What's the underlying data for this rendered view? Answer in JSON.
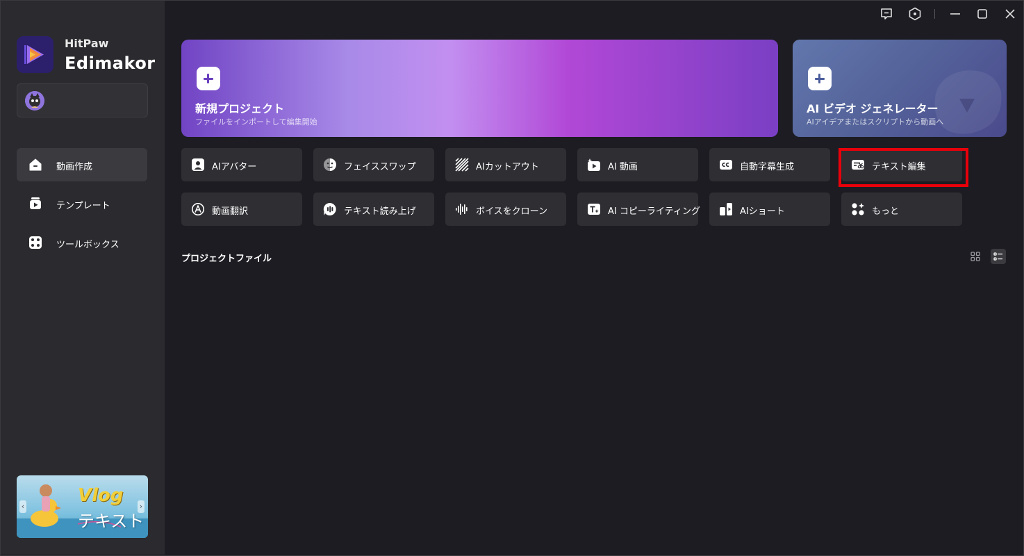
{
  "brand": {
    "line1": "HitPaw",
    "line2": "Edimakor"
  },
  "sidebar": {
    "items": [
      {
        "label": "動画作成",
        "icon": "home-icon",
        "active": true
      },
      {
        "label": "テンプレート",
        "icon": "template-icon",
        "active": false
      },
      {
        "label": "ツールボックス",
        "icon": "toolbox-icon",
        "active": false
      }
    ],
    "banner": {
      "title": "Vlog",
      "subtitle": "テキスト"
    }
  },
  "titlebar": {
    "icons": [
      "feedback-icon",
      "settings-hex-icon",
      "minimize-icon",
      "maximize-icon",
      "close-icon"
    ]
  },
  "hero": [
    {
      "title": "新規プロジェクト",
      "subtitle": "ファイルをインポートして編集開始"
    },
    {
      "title": "AI ビデオ ジェネレーター",
      "subtitle": "AIアイデアまたはスクリプトから動画へ"
    }
  ],
  "tools": [
    {
      "label": "AIアバター",
      "icon": "avatar-icon"
    },
    {
      "label": "フェイススワップ",
      "icon": "face-swap-icon"
    },
    {
      "label": "AIカットアウト",
      "icon": "cutout-icon"
    },
    {
      "label": "AI 動画",
      "icon": "ai-video-icon"
    },
    {
      "label": "自動字幕生成",
      "icon": "cc-icon"
    },
    {
      "label": "テキスト編集",
      "icon": "text-edit-icon"
    },
    {
      "label": "動画翻訳",
      "icon": "translate-icon"
    },
    {
      "label": "テキスト読み上げ",
      "icon": "tts-icon"
    },
    {
      "label": "ボイスをクローン",
      "icon": "voice-clone-icon"
    },
    {
      "label": "AI コピーライティング",
      "icon": "copywriting-icon"
    },
    {
      "label": "AIショート",
      "icon": "ai-short-icon"
    },
    {
      "label": "もっと",
      "icon": "more-icon"
    }
  ],
  "projects": {
    "title": "プロジェクトファイル",
    "view_mode": "list"
  },
  "colors": {
    "highlight": "#e8000a",
    "sidebar_bg": "#2b2b2f",
    "main_bg": "#1d1c22"
  }
}
